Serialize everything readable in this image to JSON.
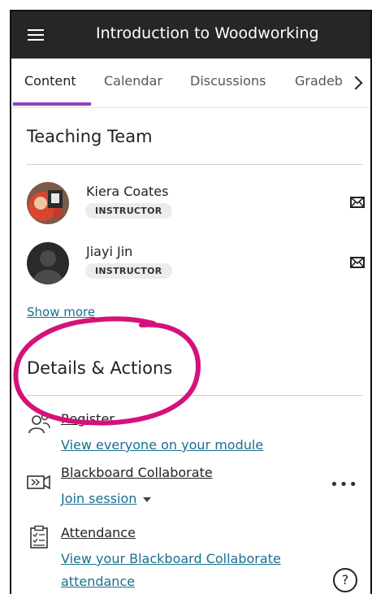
{
  "header": {
    "title": "Introduction to Woodworking",
    "menu_icon": "hamburger-icon"
  },
  "tabs": [
    {
      "label": "Content",
      "active": true
    },
    {
      "label": "Calendar",
      "active": false
    },
    {
      "label": "Discussions",
      "active": false
    },
    {
      "label": "Gradeb",
      "active": false
    }
  ],
  "teaching_team": {
    "heading": "Teaching Team",
    "members": [
      {
        "name": "Kiera Coates",
        "role": "INSTRUCTOR"
      },
      {
        "name": "Jiayi Jin",
        "role": "INSTRUCTOR"
      }
    ],
    "show_more": "Show more"
  },
  "details": {
    "heading": "Details & Actions",
    "items": [
      {
        "title": "Register",
        "sub": "View everyone on your module",
        "icon": "people-icon"
      },
      {
        "title": "Blackboard Collaborate",
        "sub": "Join session",
        "icon": "video-icon"
      },
      {
        "title": "Attendance",
        "sub": "View your Blackboard Collaborate attendance",
        "icon": "clipboard-icon"
      }
    ]
  },
  "help_icon": "?",
  "colors": {
    "topbar": "#262626",
    "accent": "#8e3fbd",
    "link": "#1a6e8f",
    "annotation": "#d4127a"
  }
}
